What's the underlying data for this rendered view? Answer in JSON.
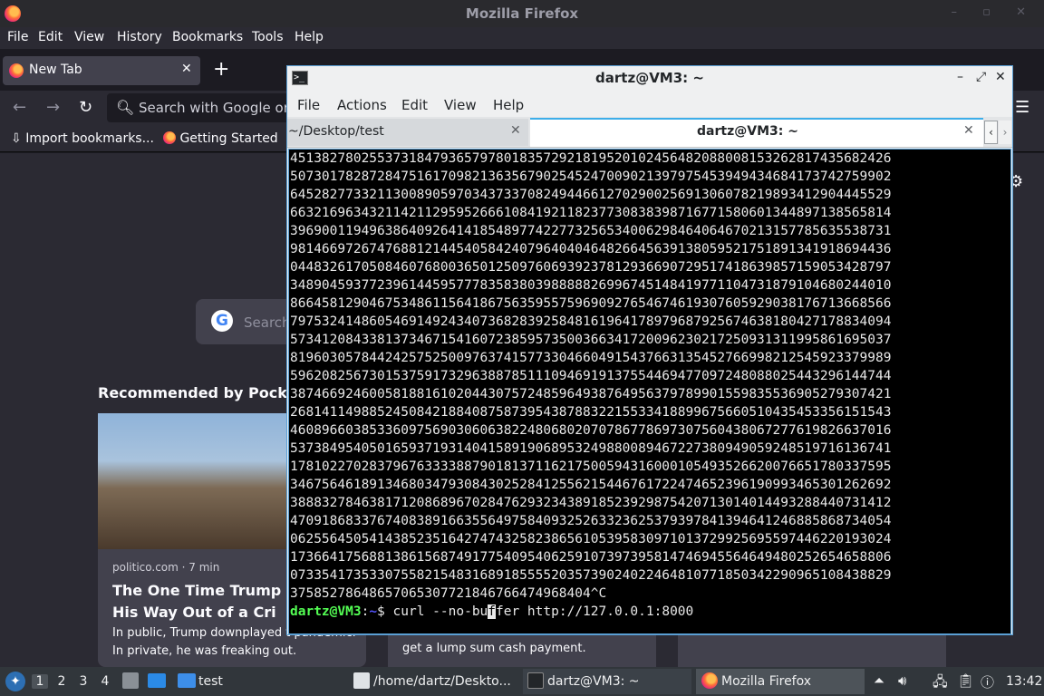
{
  "firefox": {
    "window_title": "Mozilla Firefox",
    "menu": [
      "File",
      "Edit",
      "View",
      "History",
      "Bookmarks",
      "Tools",
      "Help"
    ],
    "tab_label": "New Tab",
    "url_placeholder": "Search with Google or e",
    "bookmarks": [
      "Import bookmarks...",
      "Getting Started"
    ],
    "search_placeholder": "Search",
    "pocket_heading": "Recommended by Pocket",
    "card1": {
      "source": "politico.com · 7 min",
      "title": "The One Time Trump Co Lie His Way Out of a Cri",
      "excerpt": "In public, Trump downplayed t pandemic. In private, he was freaking out."
    },
    "card2": {
      "excerpt": "get a lump sum cash payment."
    }
  },
  "terminal": {
    "window_title": "dartz@VM3: ~",
    "menu": [
      "File",
      "Actions",
      "Edit",
      "View",
      "Help"
    ],
    "tabs": [
      "~/Desktop/test",
      "dartz@VM3: ~"
    ],
    "output": "4513827802553731847936579780183572921819520102456482088008153262817435682426\n5073017828728475161709821363567902545247009021397975453949434684173742759902\n6452827733211300890597034373370824944661270290025691306078219893412904445529\n6632169634321142112959526661084192118237730838398716771580601344897138565814\n3969001194963864092641418548977422773256534006298464064670213157785635538731\n9814669726747688121445405842407964040464826645639138059521751891341918694436\n0448326170508460768003650125097606939237812936690729517418639857159053428797\n3489045937723961445957778358380398888826996745148419771104731879104680244010\n8664581290467534861156418675635955759690927654674619307605929038176713668566\n7975324148605469149243407368283925848161964178979687925674638180427178834094\n5734120843381373467154160723859573500366341720096230217250931311995861695037\n8196030578442425752500976374157733046604915437663135452766998212545923379989\n5962082567301537591732963887851110946919137554469477097248088025443296144744\n3874669246005818816102044307572485964938764956379789901559835536905279307421\n2681411498852450842188408758739543878832215533418899675660510435453356151543\n4608966038533609756903060638224806802070786778697307560438067277619826637016\n5373849540501659371931404158919068953249880089467227380949059248519716136741\n1781022702837967633338879018137116217500594316000105493526620076651780337595\n3467564618913468034793084302528412556215446761722474652396190993465301262692\n3888327846381712086896702847629323438918523929875420713014014493288440731412\n4709186833767408389166355649758409325263323625379397841394641246885868734054\n0625564505414385235164274743258238656105395830971013729925695597446220193024\n1736641756881386156874917754095406259107397395814746945564649480252654658806\n0733541735330755821548316891855552035739024022464810771850342290965108438829\n37585278648657065307721846766474968404^C",
    "prompt_user": "dartz@VM3",
    "prompt_sep": ":",
    "prompt_path": "~",
    "prompt_dollar": "$ ",
    "command_before_cursor": "curl --no-bu",
    "command_cursor_char": "f",
    "command_after_cursor": "fer http://127.0.0.1:8000"
  },
  "taskbar": {
    "workspaces": [
      "1",
      "2",
      "3",
      "4"
    ],
    "folder_label": "test",
    "tasks": [
      "/home/dartz/Deskto...",
      "dartz@VM3: ~",
      "Mozilla Firefox"
    ],
    "clock": "13:42"
  },
  "colors": {
    "terminal_bg": "#000000",
    "prompt_user": "#54ff54",
    "prompt_path": "#5454ff",
    "accent": "#3daee9"
  }
}
